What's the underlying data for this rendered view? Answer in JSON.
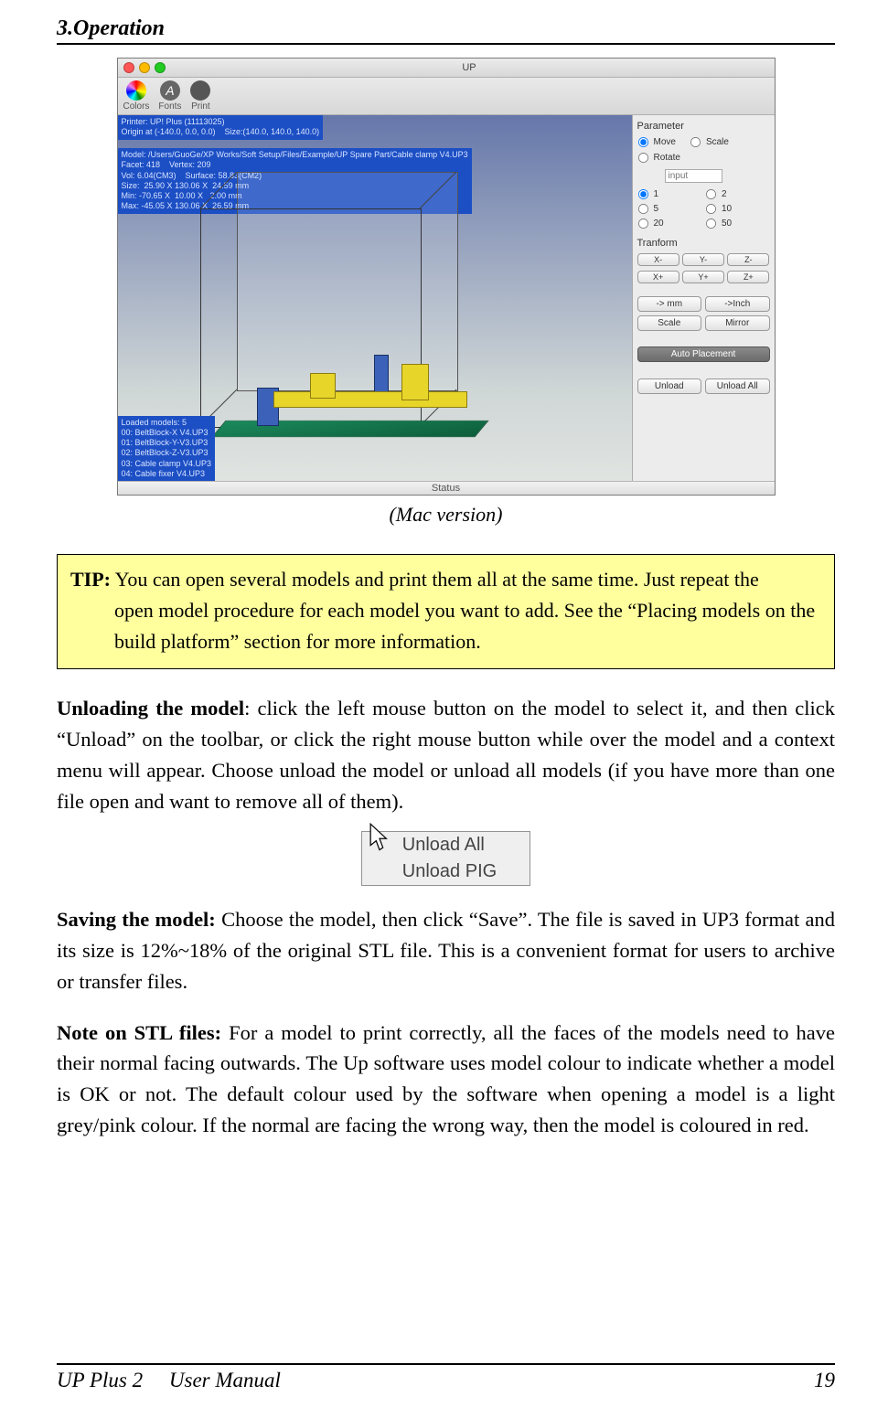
{
  "header": {
    "title": "3.Operation"
  },
  "mac": {
    "window_title": "UP",
    "toolbar": {
      "colors": "Colors",
      "fonts": "Fonts",
      "print": "Print"
    },
    "info_top": "Printer: UP! Plus (11113025)\nOrigin at (-140.0, 0.0, 0.0)    Size:(140.0, 140.0, 140.0)",
    "info_mid": "Model: /Users/GuoGe/XP Works/Soft Setup/Files/Example/UP Spare Part/Cable clamp V4.UP3\nFacet: 418    Vertex: 209\nVol: 6.04(CM3)    Surface: 58.83(CM2)\nSize:  25.90 X 130.06 X  24.59 mm\nMin: -70.65 X  10.00 X   2.00 mm\nMax: -45.05 X 130.06 X  26.59 mm",
    "info_bot": "Loaded models: 5\n00: BeltBlock-X V4.UP3\n01: BeltBlock-Y-V3.UP3\n02: BeltBlock-Z-V3.UP3\n03: Cable clamp V4.UP3\n04: Cable fixer V4.UP3",
    "status": "Status",
    "panel": {
      "parameter": "Parameter",
      "move": "Move",
      "scale": "Scale",
      "rotate": "Rotate",
      "input_placeholder": "input",
      "opts": {
        "o1": "1",
        "o2": "2",
        "o5": "5",
        "o10": "10",
        "o20": "20",
        "o50": "50"
      },
      "transform": "Tranform",
      "xm": "X-",
      "ym": "Y-",
      "zm": "Z-",
      "xp": "X+",
      "yp": "Y+",
      "zp": "Z+",
      "to_mm": "-> mm",
      "to_in": "->Inch",
      "scale_btn": "Scale",
      "mirror": "Mirror",
      "auto": "Auto Placement",
      "unload": "Unload",
      "unload_all": "Unload All"
    }
  },
  "caption": "(Mac version)",
  "tip": {
    "label": "TIP:",
    "line1": " You can open several models and print them all at the same time. Just repeat the",
    "line2": "open model procedure for each model you want to add. See the “Placing models on the build platform” section for more information."
  },
  "para_unload": {
    "label": "Unloading the model",
    "text": ": click the left mouse button on the model to select it, and then click “Unload” on the toolbar, or click the right mouse button while over the model and a context menu will appear. Choose unload the model or unload all models (if you have more than one file open and want to remove all of them)."
  },
  "ctx": {
    "item1": "Unload All",
    "item2": "Unload PIG"
  },
  "para_save": {
    "label": "Saving the model:",
    "text": " Choose the model, then click “Save”. The file is saved in UP3 format and its size is 12%~18% of the original STL file. This is a convenient format for users to archive or transfer files."
  },
  "para_note": {
    "label": "Note on STL files:",
    "text": " For a model to print correctly, all the faces of the models need to have their normal facing outwards. The Up software uses model colour to indicate whether a model is OK or not. The default colour used by the software when opening a model is a light grey/pink colour. If the normal are facing the wrong way, then the model is coloured in red."
  },
  "footer": {
    "left1": "UP Plus 2",
    "left2": "User  Manual",
    "page": "19"
  }
}
